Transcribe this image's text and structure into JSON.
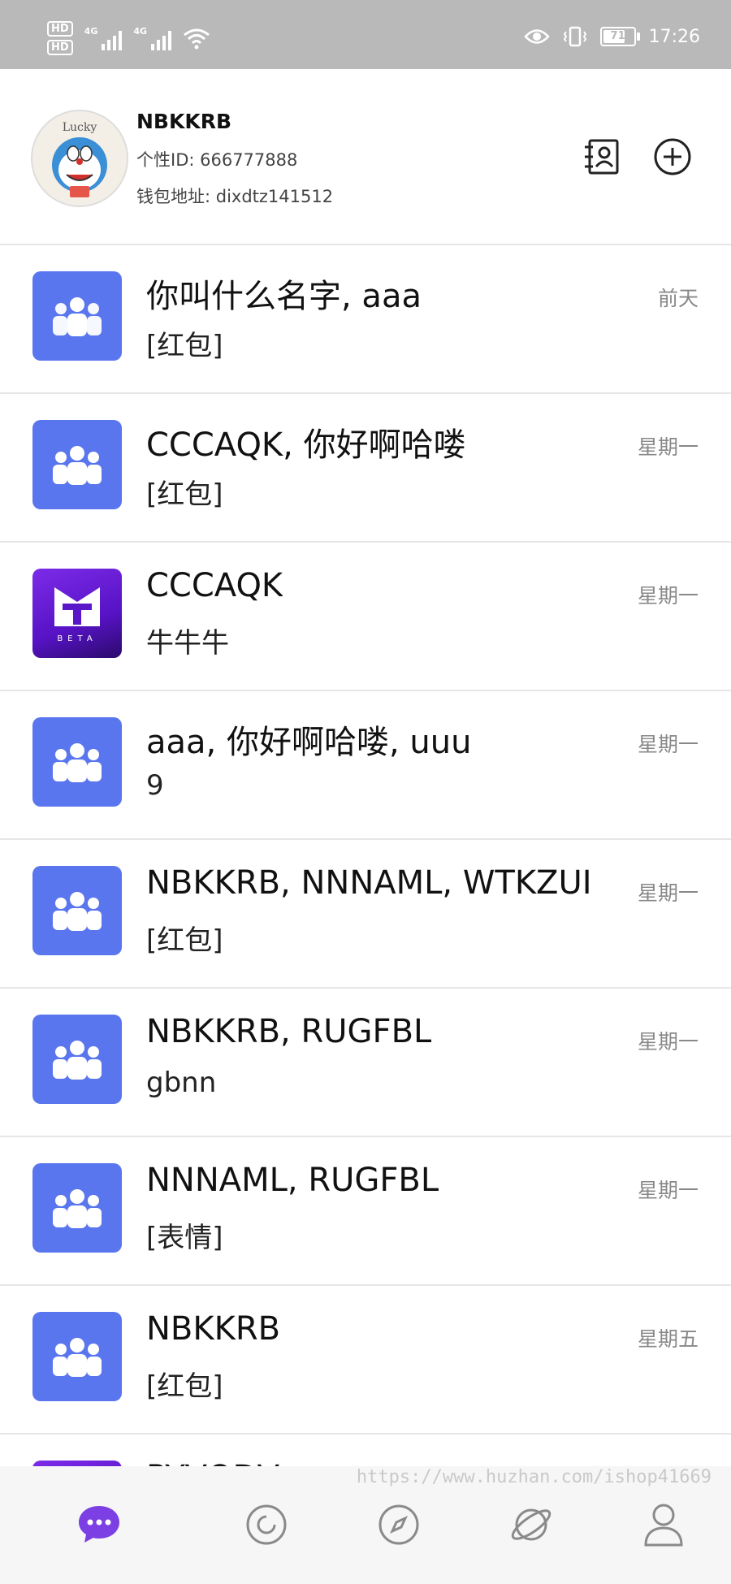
{
  "status_bar": {
    "hd1": "HD",
    "hd2": "HD",
    "net1": "4G",
    "net2": "4G",
    "wifi_label": "6",
    "battery": "71",
    "time": "17:26"
  },
  "profile": {
    "name": "NBKKRB",
    "id_line": "个性ID: 666777888",
    "wallet_line": "钱包地址: dixdtz141512",
    "avatar_text": "Lucky"
  },
  "chats": [
    {
      "title": "你叫什么名字, aaa",
      "preview": "[红包]",
      "time": "前天",
      "avatar": "group-icon"
    },
    {
      "title": "CCCAQK, 你好啊哈喽",
      "preview": "[红包]",
      "time": "星期一",
      "avatar": "group-icon"
    },
    {
      "title": "CCCAQK",
      "preview": "牛牛牛",
      "time": "星期一",
      "avatar": "app-logo",
      "avatar_caption": "BETA"
    },
    {
      "title": "aaa, 你好啊哈喽, uuu",
      "preview": "9",
      "time": "星期一",
      "avatar": "group-icon"
    },
    {
      "title": "NBKKRB, NNNAML, WTKZUI",
      "preview": "[红包]",
      "time": "星期一",
      "avatar": "group-icon"
    },
    {
      "title": "NBKKRB, RUGFBL",
      "preview": "gbnn",
      "time": "星期一",
      "avatar": "group-icon"
    },
    {
      "title": "NNNAML, RUGFBL",
      "preview": "[表情]",
      "time": "星期一",
      "avatar": "group-icon"
    },
    {
      "title": "NBKKRB",
      "preview": "[红包]",
      "time": "星期五",
      "avatar": "group-icon"
    },
    {
      "title": "PYVQDV",
      "preview": "",
      "time": "",
      "avatar": "app-logo"
    }
  ],
  "watermark": "https://www.huzhan.com/ishop41669",
  "nav": {
    "chat": "chat-bubble-icon",
    "moments": "moments-icon",
    "discover": "compass-icon",
    "planet": "planet-icon",
    "me": "person-icon"
  },
  "colors": {
    "accent": "#7b3fe4",
    "group_avatar": "#5a76ee",
    "nav_inactive": "#8a8a8a"
  }
}
